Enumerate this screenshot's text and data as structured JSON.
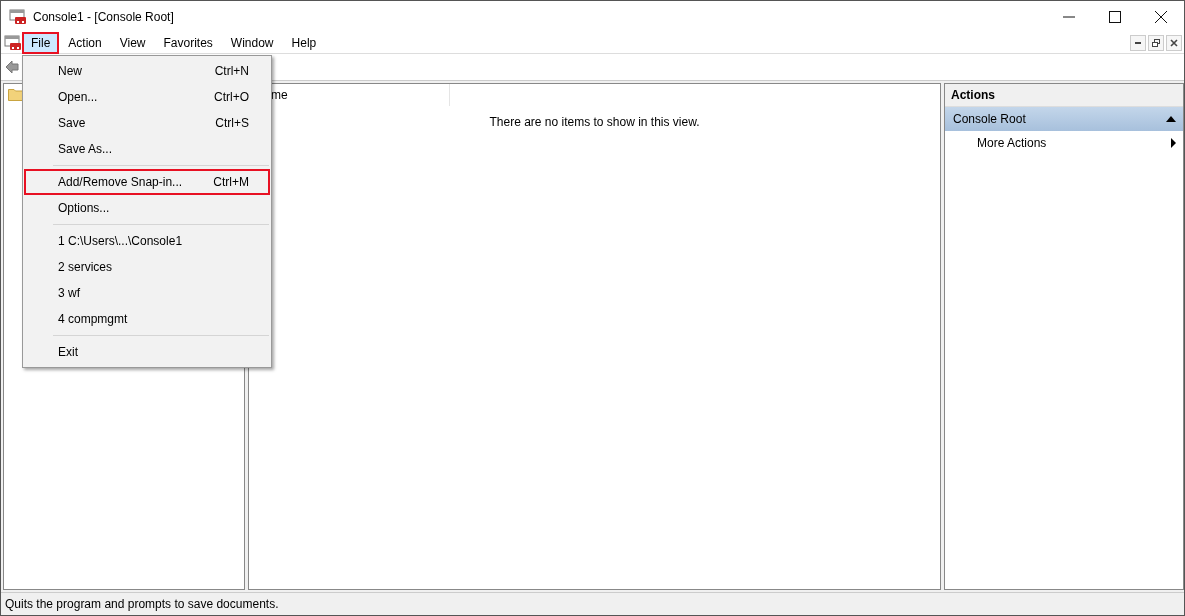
{
  "window": {
    "title": "Console1 - [Console Root]"
  },
  "menu_bar": [
    {
      "label": "File",
      "selected": true,
      "highlighted": true
    },
    {
      "label": "Action",
      "selected": false,
      "highlighted": false
    },
    {
      "label": "View",
      "selected": false,
      "highlighted": false
    },
    {
      "label": "Favorites",
      "selected": false,
      "highlighted": false
    },
    {
      "label": "Window",
      "selected": false,
      "highlighted": false
    },
    {
      "label": "Help",
      "selected": false,
      "highlighted": false
    }
  ],
  "file_menu": [
    {
      "kind": "item",
      "label": "New",
      "shortcut": "Ctrl+N",
      "highlighted": false
    },
    {
      "kind": "item",
      "label": "Open...",
      "shortcut": "Ctrl+O",
      "highlighted": false
    },
    {
      "kind": "item",
      "label": "Save",
      "shortcut": "Ctrl+S",
      "highlighted": false
    },
    {
      "kind": "item",
      "label": "Save As...",
      "highlighted": false
    },
    {
      "kind": "separator"
    },
    {
      "kind": "item",
      "label": "Add/Remove Snap-in...",
      "shortcut": "Ctrl+M",
      "highlighted": true
    },
    {
      "kind": "item",
      "label": "Options...",
      "highlighted": false
    },
    {
      "kind": "separator"
    },
    {
      "kind": "item",
      "label": "1 C:\\Users\\...\\Console1",
      "highlighted": false
    },
    {
      "kind": "item",
      "label": "2 services",
      "highlighted": false
    },
    {
      "kind": "item",
      "label": "3 wf",
      "highlighted": false
    },
    {
      "kind": "item",
      "label": "4 compmgmt",
      "highlighted": false
    },
    {
      "kind": "separator"
    },
    {
      "kind": "item",
      "label": "Exit",
      "highlighted": false
    }
  ],
  "list_view": {
    "columns": [
      "me"
    ],
    "empty_message": "There are no items to show in this view."
  },
  "actions_pane": {
    "title": "Actions",
    "section": "Console Root",
    "expanded": true,
    "items": [
      "More Actions"
    ]
  },
  "status_bar": "Quits the program and prompts to save documents."
}
